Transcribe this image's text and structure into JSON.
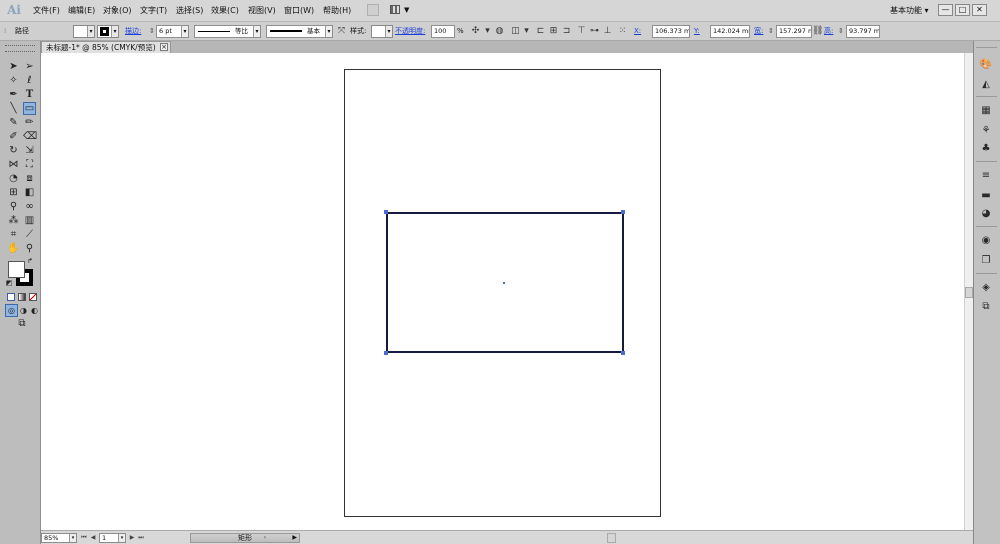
{
  "app": {
    "logo": "Ai",
    "workspace_label": "基本功能 ▾"
  },
  "menu": {
    "items": [
      "文件(F)",
      "编辑(E)",
      "对象(O)",
      "文字(T)",
      "选择(S)",
      "效果(C)",
      "视图(V)",
      "窗口(W)",
      "帮助(H)"
    ]
  },
  "window_controls": {
    "minimize": "—",
    "restore": "□",
    "close": "✕"
  },
  "control_bar": {
    "object_type": "路径",
    "stroke_label": "描边:",
    "stroke_weight": "6 pt",
    "profile_label": "等比",
    "brush_label": "基本",
    "style_label": "样式:",
    "opacity_label": "不透明度:",
    "opacity_value": "100",
    "opacity_unit": "%",
    "x_label": "X:",
    "x_value": "106.373 mm",
    "y_label": "Y:",
    "y_value": "142.024 mm",
    "w_label": "宽:",
    "w_value": "157.297 mm",
    "h_label": "高:",
    "h_value": "93.797 mm"
  },
  "document_tab": {
    "title": "未标题-1* @ 85% (CMYK/预览)",
    "close": "×"
  },
  "status_bar": {
    "zoom": "85%",
    "artboard_number": "1",
    "current_tool": "矩形",
    "nav_first": "⏮",
    "nav_prev": "◀",
    "nav_next": "▶",
    "nav_last": "⏭",
    "status_arrow": "▶"
  },
  "colors": {
    "rect_stroke": "#161a3e",
    "selection_handle": "#4d6cd1",
    "link_text": "#1a3fd6"
  }
}
